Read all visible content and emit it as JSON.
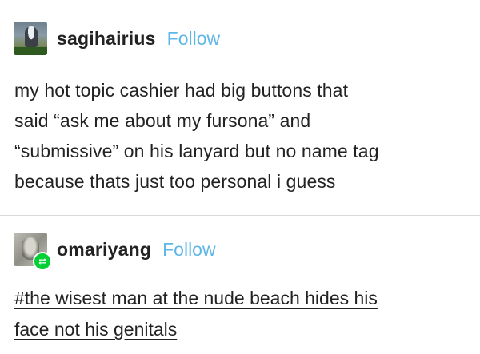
{
  "posts": [
    {
      "username": "sagihairius",
      "follow_label": "Follow",
      "avatar_icon": "avatar-photo-figure",
      "body_lines": [
        "my hot topic cashier had big buttons that",
        "said “ask me about my fursona” and",
        "“submissive” on his lanyard but no name tag",
        "because thats just too personal i guess"
      ]
    },
    {
      "username": "omariyang",
      "follow_label": "Follow",
      "avatar_icon": "avatar-photo-face",
      "badge_icon": "reblog-icon",
      "badge_color": "#00cf35",
      "tag_lines": [
        "#the wisest man at the nude beach hides his",
        "face not his genitals"
      ]
    }
  ],
  "colors": {
    "follow": "#5fb7e8",
    "text": "#222222",
    "divider": "#d9d9d9"
  }
}
